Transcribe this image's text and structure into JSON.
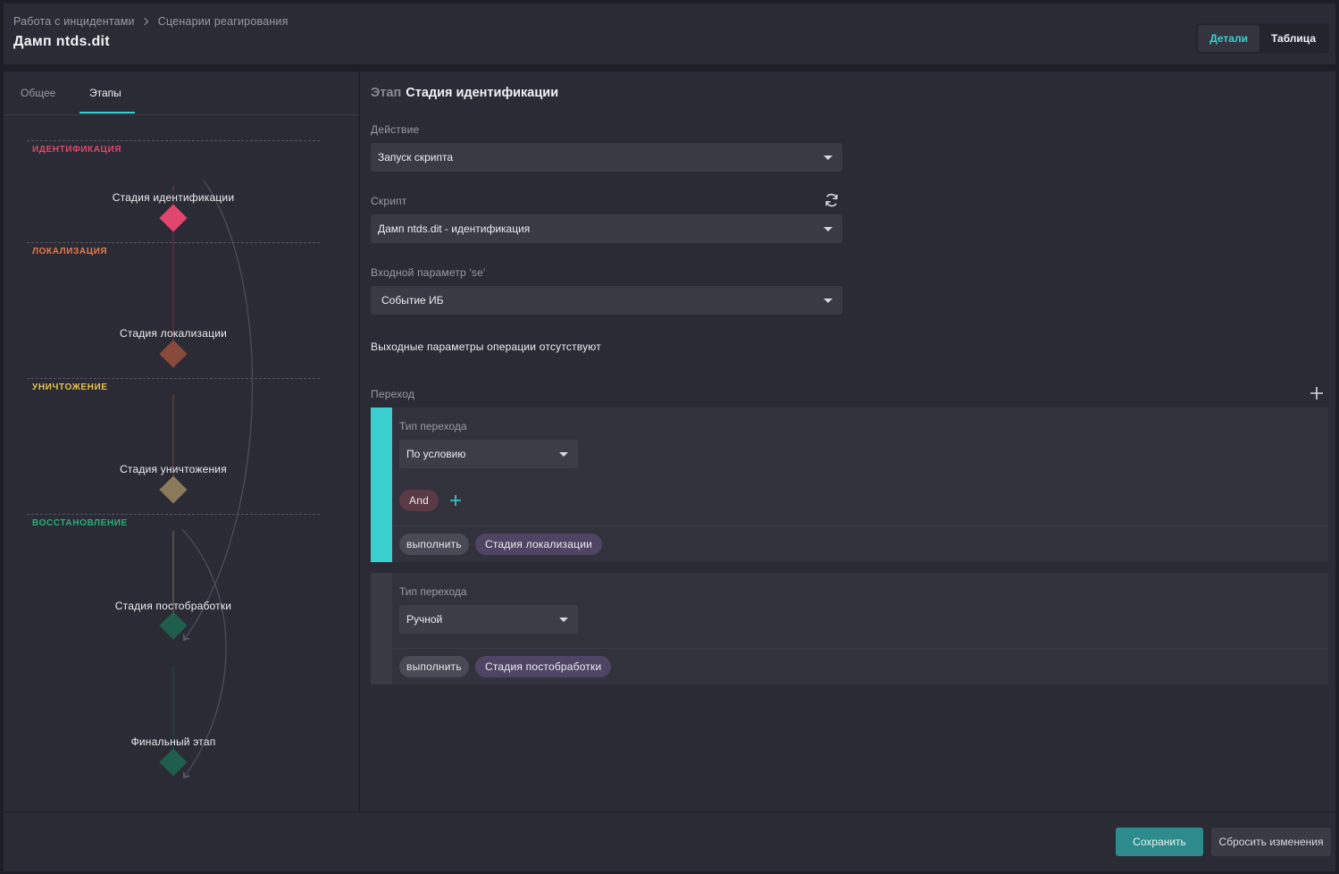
{
  "breadcrumb": {
    "parent": "Работа с инцидентами",
    "current": "Сценарии реагирования"
  },
  "page_title": "Дамп ntds.dit",
  "view_switch": {
    "details": "Детали",
    "table": "Таблица",
    "active": "details"
  },
  "left_tabs": {
    "general": "Общее",
    "stages": "Этапы",
    "active": "stages"
  },
  "flow": {
    "phases": [
      {
        "label": "ИДЕНТИФИКАЦИЯ",
        "color": "#e0466e"
      },
      {
        "label": "ЛОКАЛИЗАЦИЯ",
        "color": "#e87a4a"
      },
      {
        "label": "УНИЧТОЖЕНИЕ",
        "color": "#e8c24a"
      },
      {
        "label": "ВОССТАНОВЛЕНИЕ",
        "color": "#2cae78"
      }
    ],
    "nodes": [
      {
        "label": "Стадия идентификации",
        "color": "#e0466e"
      },
      {
        "label": "Стадия локализации",
        "color": "#8a4a3a"
      },
      {
        "label": "Стадия уничтожения",
        "color": "#8a7a5a"
      },
      {
        "label": "Стадия постобработки",
        "color": "#1f5e4a"
      },
      {
        "label": "Финальный этап",
        "color": "#1f5e4a"
      }
    ]
  },
  "stage": {
    "prefix": "Этап",
    "name": "Стадия идентификации",
    "action_label": "Действие",
    "action_value": "Запуск скрипта",
    "script_label": "Скрипт",
    "script_value": "Дамп ntds.dit - идентификация",
    "input_label": "Входной параметр 'se'",
    "input_value": "Событие ИБ",
    "no_output": "Выходные параметры операции отсутствуют",
    "transition_label": "Переход"
  },
  "transitions": [
    {
      "type_label": "Тип перехода",
      "type_value": "По условию",
      "and_label": "And",
      "action": "выполнить",
      "target": "Стадия локализации",
      "accent": "#3ccfcf"
    },
    {
      "type_label": "Тип перехода",
      "type_value": "Ручной",
      "action": "выполнить",
      "target": "Стадия постобработки",
      "accent": "#3a3a45"
    }
  ],
  "footer": {
    "save": "Сохранить",
    "reset": "Сбросить изменения"
  },
  "colors": {
    "accent": "#3ccfcf",
    "save_button": "#2e8b8b"
  }
}
